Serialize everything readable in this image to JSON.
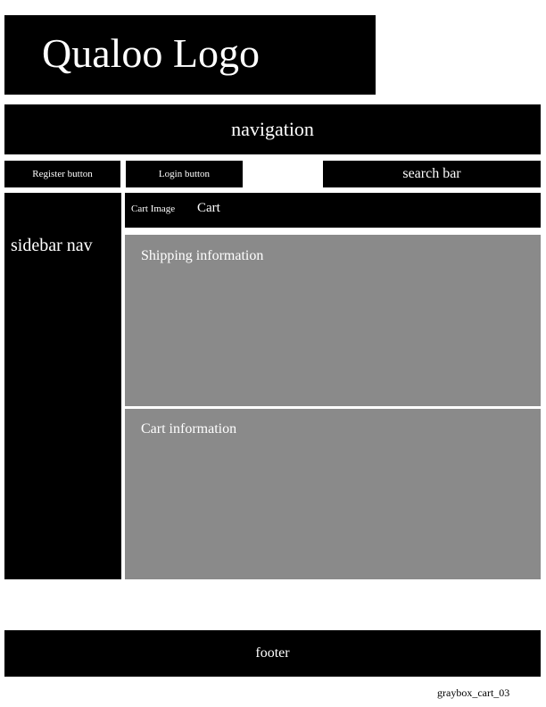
{
  "header": {
    "logo_text": "Qualoo Logo"
  },
  "navigation": {
    "label": "navigation"
  },
  "account": {
    "register_label": "Register button",
    "login_label": "Login button"
  },
  "search": {
    "label": "search bar"
  },
  "sidebar": {
    "label": "sidebar nav"
  },
  "cart_bar": {
    "image_label": "Cart Image",
    "title": "Cart"
  },
  "main": {
    "shipping_label": "Shipping information",
    "cart_info_label": "Cart information"
  },
  "footer": {
    "label": "footer"
  },
  "file_caption": "graybox_cart_03",
  "colors": {
    "block": "#000000",
    "panel": "#8a8a8a",
    "text": "#ffffff"
  }
}
